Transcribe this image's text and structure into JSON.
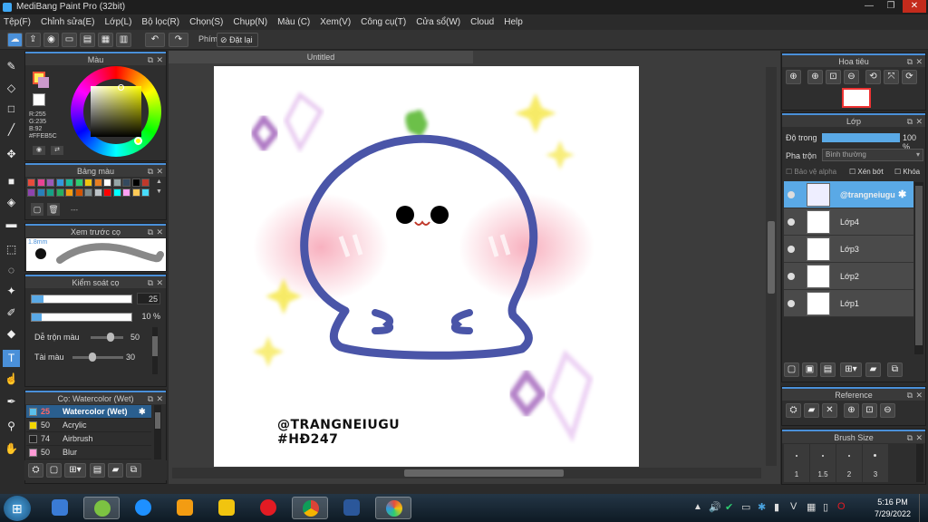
{
  "window": {
    "title": "MediBang Paint Pro (32bit)",
    "minimize": "—",
    "maximize": "❐",
    "close": "✕"
  },
  "menu": [
    "Tệp(F)",
    "Chỉnh sửa(E)",
    "Lớp(L)",
    "Bộ lọc(R)",
    "Chọn(S)",
    "Chụp(N)",
    "Màu (C)",
    "Xem(V)",
    "Công cụ(T)",
    "Cửa sổ(W)",
    "Cloud",
    "Help"
  ],
  "toolbar": {
    "key_label": "Phím",
    "reset_label": "Đặt lại"
  },
  "document": {
    "tab": "Untitled"
  },
  "color_panel": {
    "title": "Màu",
    "r": "R:255",
    "g": "G:235",
    "b": "B:92",
    "hex": "#FFEB5C",
    "fg": "#FFEB5C",
    "bg": "#FFFFFF"
  },
  "palette_panel": {
    "title": "Bảng màu",
    "dots": "---"
  },
  "brush_preview": {
    "title": "Xem trước cọ",
    "size": "1.8mm"
  },
  "brush_control": {
    "title": "Kiểm soát cọ",
    "size_value": "25",
    "opacity_value": "10 %",
    "size_fill": 0.12,
    "opacity_fill": 0.1,
    "blend_label": "Dễ trộn màu",
    "blend_value": "50",
    "blend_fill": 0.6,
    "amount_label": "Tài màu",
    "amount_value": "30",
    "amount_fill": 0.4
  },
  "brush_list": {
    "title": "Cọ: Watercolor (Wet)",
    "items": [
      {
        "size": "25",
        "name": "Watercolor (Wet)",
        "color": "#5bc0eb"
      },
      {
        "size": "50",
        "name": "Acrylic",
        "color": "#f2d600"
      },
      {
        "size": "74",
        "name": "Airbrush",
        "color": "#222222"
      },
      {
        "size": "50",
        "name": "Blur",
        "color": "#ff9ad5"
      }
    ]
  },
  "navigator": {
    "title": "Hoa tiêu"
  },
  "layer_panel": {
    "title": "Lớp",
    "opacity_label": "Độ trong",
    "opacity_value": "100 %",
    "blend_label": "Pha trộn",
    "blend_value": "Bình thường",
    "protect_alpha": "Bảo vệ alpha",
    "clipping": "Xén bớt",
    "lock": "Khóa",
    "layers": [
      {
        "name": "@trangneiugu",
        "selected": true
      },
      {
        "name": "Lớp4",
        "selected": false
      },
      {
        "name": "Lớp3",
        "selected": false
      },
      {
        "name": "Lớp2",
        "selected": false
      },
      {
        "name": "Lớp1",
        "selected": false
      }
    ]
  },
  "reference_panel": {
    "title": "Reference"
  },
  "brush_size_panel": {
    "title": "Brush Size",
    "sizes": [
      "1",
      "1.5",
      "2",
      "3"
    ]
  },
  "canvas_text": {
    "line1": "@TRANGNEIUGU",
    "line2": "#HĐ247"
  },
  "taskbar": {
    "time": "5:16 PM",
    "date": "7/29/2022"
  },
  "colors": {
    "accent": "#4a90d9",
    "outline": "#4a55a8",
    "sparkle_purple": "#9b59b6",
    "sparkle_yellow": "#f5e642"
  }
}
